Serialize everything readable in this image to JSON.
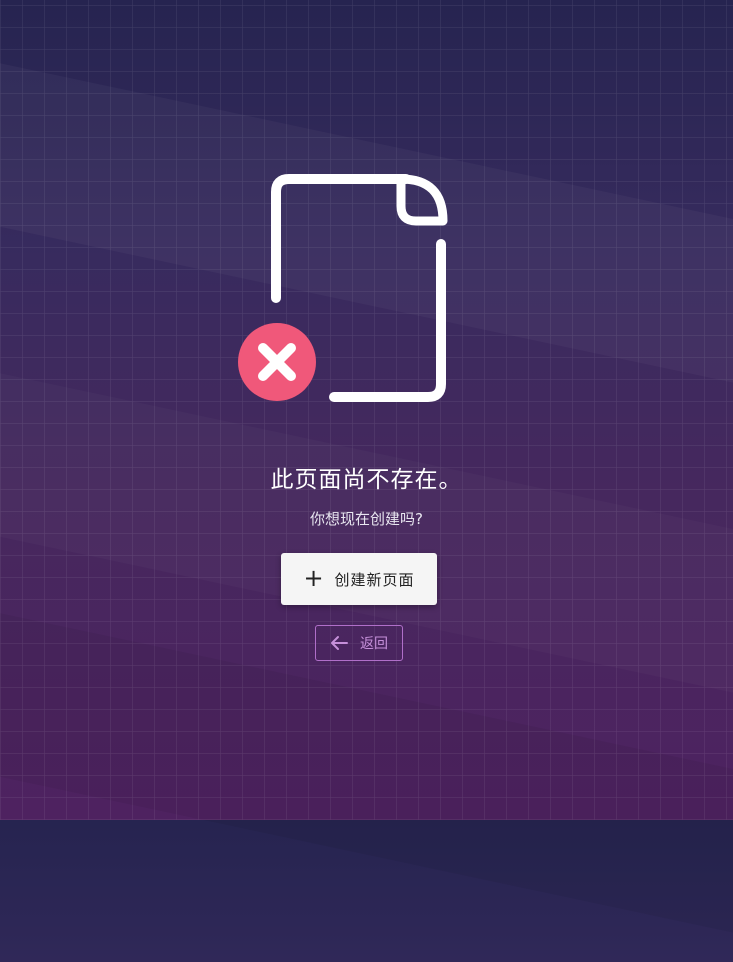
{
  "colors": {
    "error_badge": "#f0587a",
    "back_accent": "#c690da"
  },
  "icons": {
    "document": "document-icon",
    "error": "error-x-icon",
    "create": "plus-icon",
    "back": "arrow-left-icon"
  },
  "main": {
    "message": "此页面尚不存在。",
    "question": "你想现在创建吗?",
    "create_button": "创建新页面",
    "back_button": "返回"
  }
}
